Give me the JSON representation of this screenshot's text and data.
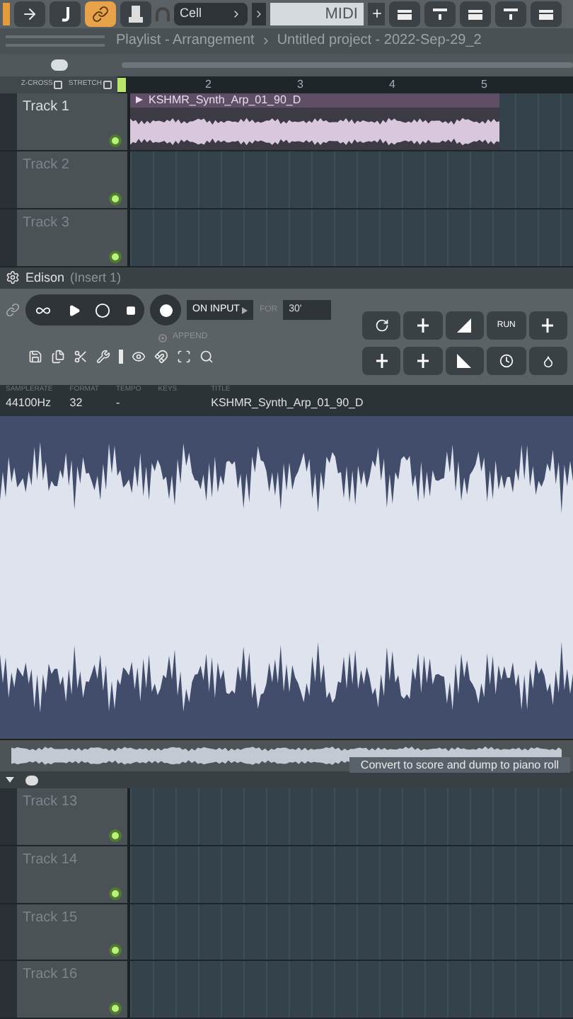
{
  "toolbar": {
    "pattern": "Cell",
    "midi_field": "MIDI"
  },
  "playlist": {
    "title": "Playlist - Arrangement",
    "project": "Untitled project - 2022-Sep-29_2",
    "options": [
      {
        "label": "Z-CROSS",
        "checked": false
      },
      {
        "label": "STRETCH",
        "checked": false
      }
    ],
    "ruler": [
      "2",
      "3",
      "4",
      "5"
    ],
    "clip": {
      "name": "KSHMR_Synth_Arp_01_90_D"
    },
    "tracks": [
      {
        "name": "Track 1",
        "active": true
      },
      {
        "name": "Track 2",
        "active": false
      },
      {
        "name": "Track 3",
        "active": false
      }
    ]
  },
  "edison": {
    "title": "Edison",
    "insert": "(Insert 1)",
    "record_mode": "ON INPUT",
    "for_label": "FOR",
    "duration": "30'",
    "append": {
      "label": "APPEND",
      "checked": true
    },
    "run_label": "RUN",
    "info": [
      {
        "label": "SAMPLERATE",
        "value": "44100Hz"
      },
      {
        "label": "FORMAT",
        "value": "32"
      },
      {
        "label": "TEMPO",
        "value": "-"
      },
      {
        "label": "KEYS"
      },
      {
        "label": "TITLE",
        "value": "KSHMR_Synth_Arp_01_90_D"
      }
    ],
    "tooltip": "Convert to score and dump to piano roll"
  },
  "lower_tracks": [
    {
      "name": "Track 13"
    },
    {
      "name": "Track 14"
    },
    {
      "name": "Track 15"
    },
    {
      "name": "Track 16"
    }
  ]
}
